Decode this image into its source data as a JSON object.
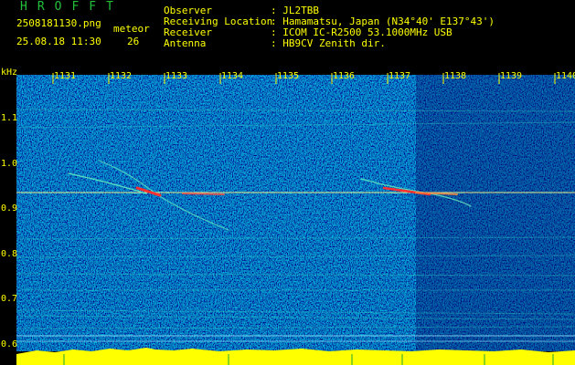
{
  "header": {
    "title": "HROFFT",
    "filename": "2508181130.png",
    "meteor_label": "meteor",
    "datetime": "25.08.18 11:30",
    "meteor_count": "26",
    "info": [
      {
        "label": "Observer",
        "value": ": JL2TBB"
      },
      {
        "label": "Receiving Location",
        "value": ": Hamamatsu, Japan (N34°40' E137°43')"
      },
      {
        "label": "Receiver",
        "value": ": ICOM IC-R2500 53.1000MHz USB"
      },
      {
        "label": "Antenna",
        "value": ": HB9CV Zenith dir."
      }
    ]
  },
  "spectrogram": {
    "y_unit": "kHz",
    "y_ticks": [
      "1.1",
      "1.0",
      "0.9",
      "0.8",
      "0.7",
      "0.6"
    ],
    "x_ticks": [
      "1131",
      "1132",
      "1133",
      "1134",
      "1135",
      "1136",
      "1137",
      "1138",
      "1139",
      "1140"
    ],
    "colors": {
      "background": "#0a1a8c",
      "label": "#ffff00",
      "carrier": "#ffff66"
    }
  }
}
